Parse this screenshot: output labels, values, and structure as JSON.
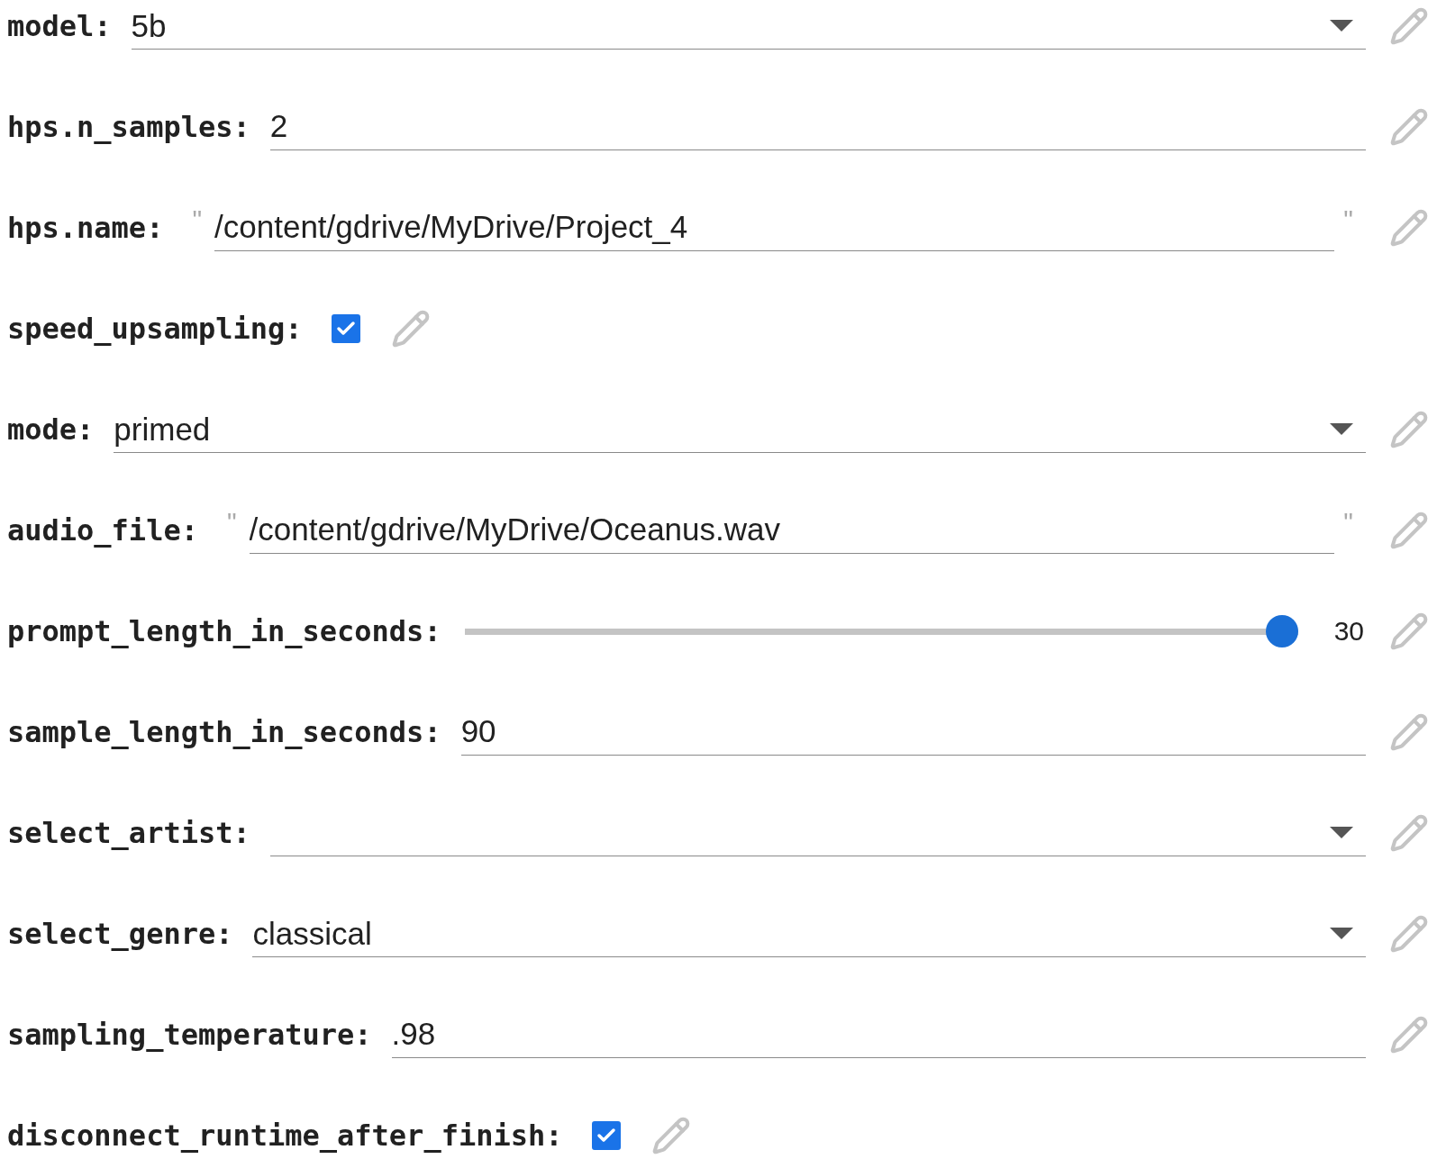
{
  "fields": [
    {
      "kind": "dropdown",
      "label": "model:",
      "value": "5b"
    },
    {
      "kind": "text",
      "label": "hps.n_samples:",
      "value": "2"
    },
    {
      "kind": "string",
      "label": "hps.name:",
      "value": "/content/gdrive/MyDrive/Project_4",
      "quote_open": "\"",
      "quote_close": "\""
    },
    {
      "kind": "checkbox",
      "label": "speed_upsampling:",
      "checked": true
    },
    {
      "kind": "dropdown",
      "label": "mode:",
      "value": "primed"
    },
    {
      "kind": "string",
      "label": "audio_file:",
      "value": "/content/gdrive/MyDrive/Oceanus.wav",
      "quote_open": "\"",
      "quote_close": "\""
    },
    {
      "kind": "slider",
      "label": "prompt_length_in_seconds:",
      "level": 1,
      "reading": "30"
    },
    {
      "kind": "text",
      "label": "sample_length_in_seconds:",
      "value": "90"
    },
    {
      "kind": "dropdown",
      "label": "select_artist:"
    },
    {
      "kind": "dropdown",
      "label": "select_genre:",
      "value": "classical"
    },
    {
      "kind": "text",
      "label": "sampling_temperature:",
      "value": ".98"
    },
    {
      "kind": "checkbox",
      "label": "disconnect_runtime_after_finish:",
      "checked": true
    }
  ]
}
